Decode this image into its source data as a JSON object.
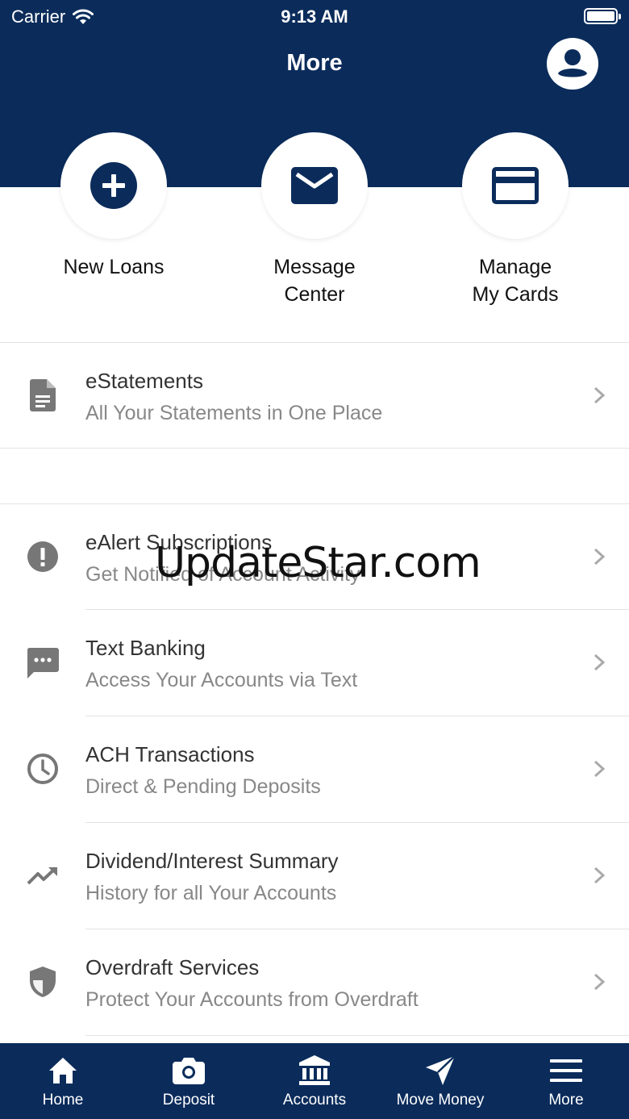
{
  "status_bar": {
    "carrier": "Carrier",
    "time": "9:13 AM"
  },
  "header": {
    "title": "More",
    "profile_icon": "account-circle-icon",
    "background": "#0b2c5b"
  },
  "quick_actions": [
    {
      "label": "New Loans",
      "icon": "plus-circle-icon"
    },
    {
      "label": "Message\nCenter",
      "icon": "mail-icon"
    },
    {
      "label": "Manage\nMy Cards",
      "icon": "credit-card-icon"
    }
  ],
  "menu": [
    {
      "title": "eStatements",
      "subtitle": "All Your Statements in One Place",
      "icon": "document-icon"
    },
    {
      "title": "eAlert Subscriptions",
      "subtitle": "Get Notified of Account Activity",
      "icon": "alert-icon"
    },
    {
      "title": "Text Banking",
      "subtitle": "Access Your Accounts via Text",
      "icon": "chat-icon"
    },
    {
      "title": "ACH Transactions",
      "subtitle": "Direct & Pending Deposits",
      "icon": "clock-icon"
    },
    {
      "title": "Dividend/Interest Summary",
      "subtitle": "History for all Your Accounts",
      "icon": "trending-up-icon"
    },
    {
      "title": "Overdraft Services",
      "subtitle": "Protect Your Accounts from Overdraft",
      "icon": "shield-icon"
    }
  ],
  "watermark": "UpdateStar.com",
  "tab_bar": {
    "tabs": [
      {
        "label": "Home",
        "icon": "home-icon"
      },
      {
        "label": "Deposit",
        "icon": "camera-icon"
      },
      {
        "label": "Accounts",
        "icon": "bank-icon"
      },
      {
        "label": "Move Money",
        "icon": "send-icon"
      },
      {
        "label": "More",
        "icon": "menu-icon"
      }
    ],
    "selected": "More"
  }
}
